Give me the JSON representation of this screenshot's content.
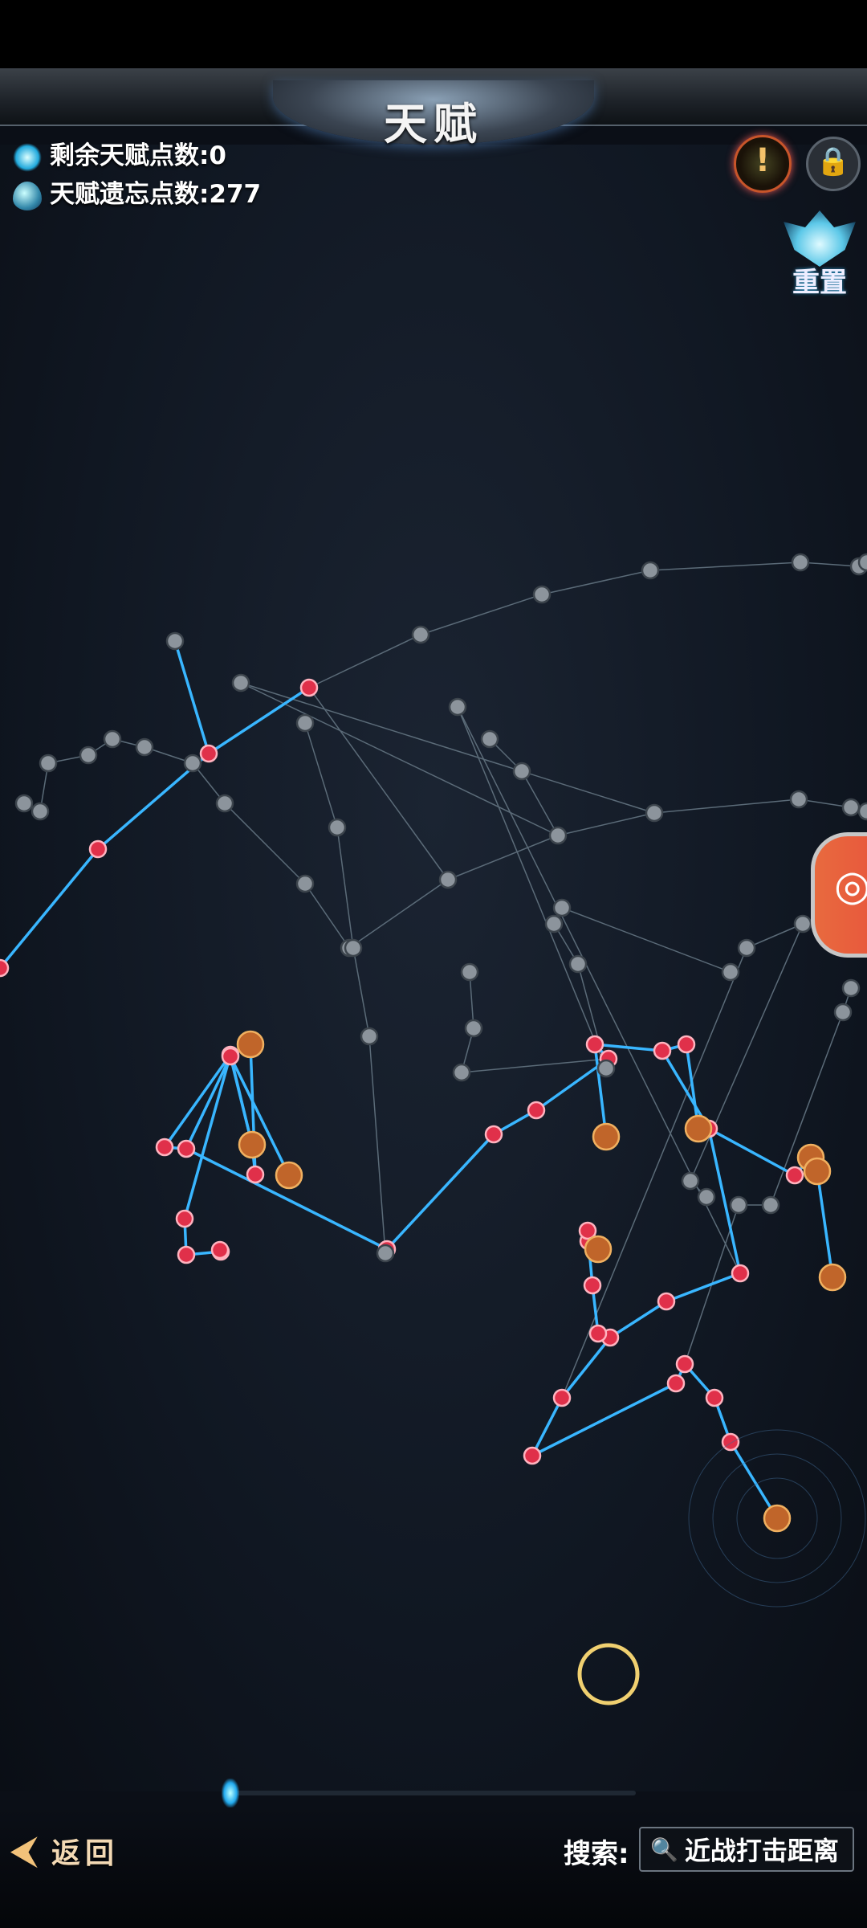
{
  "header": {
    "title": "天赋"
  },
  "stats": {
    "remaining_label": "剩余天赋点数:0",
    "forget_label": "天赋遗忘点数:277"
  },
  "buttons": {
    "help_glyph": "!",
    "lock_glyph": "🔒",
    "reset_label": "重置",
    "record_glyph": "◎",
    "back_label": "返回"
  },
  "search": {
    "label": "搜索:",
    "value": "近战打击距离",
    "icon": "search-icon"
  },
  "colors": {
    "active_link": "#39b6ff",
    "inactive_link": "#5b6b78",
    "active_node": "#e0304a",
    "inactive_node": "#8c949c",
    "highlight_ring": "#f0d070",
    "accent": "#f2c27a"
  },
  "tree": {
    "active_edges": [
      [
        0,
        1
      ],
      [
        1,
        2
      ],
      [
        2,
        3
      ],
      [
        2,
        4
      ],
      [
        5,
        6
      ],
      [
        6,
        7
      ],
      [
        6,
        8
      ],
      [
        8,
        9
      ],
      [
        9,
        10
      ],
      [
        10,
        11
      ],
      [
        5,
        12
      ],
      [
        12,
        13
      ],
      [
        13,
        14
      ],
      [
        13,
        15
      ],
      [
        15,
        16
      ],
      [
        16,
        17
      ],
      [
        12,
        18
      ],
      [
        18,
        19
      ],
      [
        19,
        20
      ],
      [
        20,
        21
      ],
      [
        21,
        22
      ],
      [
        22,
        23
      ],
      [
        22,
        24
      ],
      [
        24,
        25
      ],
      [
        25,
        26
      ],
      [
        26,
        27
      ],
      [
        27,
        28
      ],
      [
        28,
        29
      ],
      [
        25,
        30
      ],
      [
        30,
        31
      ],
      [
        31,
        32
      ],
      [
        32,
        33
      ],
      [
        33,
        34
      ],
      [
        34,
        35
      ],
      [
        35,
        36
      ],
      [
        36,
        37
      ],
      [
        37,
        38
      ],
      [
        38,
        39
      ],
      [
        39,
        40
      ],
      [
        32,
        41
      ],
      [
        41,
        42
      ],
      [
        42,
        43
      ],
      [
        43,
        44
      ],
      [
        44,
        45
      ],
      [
        24,
        46
      ],
      [
        46,
        47
      ]
    ],
    "inactive_edges": [
      [
        3,
        48
      ],
      [
        48,
        49
      ],
      [
        49,
        50
      ],
      [
        50,
        51
      ],
      [
        51,
        52
      ],
      [
        52,
        53
      ],
      [
        53,
        54
      ],
      [
        3,
        55
      ],
      [
        55,
        56
      ],
      [
        56,
        57
      ],
      [
        57,
        58
      ],
      [
        58,
        59
      ],
      [
        59,
        60
      ],
      [
        60,
        61
      ],
      [
        55,
        62
      ],
      [
        62,
        63
      ],
      [
        63,
        64
      ],
      [
        64,
        65
      ],
      [
        65,
        66
      ],
      [
        66,
        67
      ],
      [
        67,
        68
      ],
      [
        68,
        69
      ],
      [
        69,
        70
      ],
      [
        70,
        71
      ],
      [
        21,
        72
      ],
      [
        72,
        73
      ],
      [
        73,
        74
      ],
      [
        18,
        75
      ],
      [
        75,
        76
      ],
      [
        76,
        77
      ],
      [
        77,
        78
      ],
      [
        78,
        79
      ],
      [
        57,
        80
      ],
      [
        80,
        81
      ],
      [
        81,
        82
      ],
      [
        82,
        83
      ],
      [
        30,
        84
      ],
      [
        84,
        85
      ],
      [
        85,
        86
      ],
      [
        86,
        87
      ],
      [
        87,
        88
      ],
      [
        88,
        89
      ],
      [
        33,
        90
      ],
      [
        90,
        91
      ],
      [
        91,
        92
      ],
      [
        92,
        93
      ],
      [
        36,
        94
      ],
      [
        94,
        95
      ],
      [
        95,
        96
      ],
      [
        96,
        97
      ]
    ],
    "active_nodes": [
      0,
      1,
      2,
      3,
      5,
      6,
      8,
      9,
      10,
      11,
      12,
      13,
      15,
      16,
      18,
      19,
      20,
      21,
      22,
      24,
      25,
      26,
      30,
      31,
      32,
      33,
      34,
      35,
      36,
      37,
      38,
      41,
      42,
      43,
      44,
      46
    ],
    "special_nodes": [
      7,
      14,
      17,
      23,
      27,
      28,
      29,
      39,
      40,
      45,
      47
    ],
    "core_node": 40,
    "node_count": 98
  }
}
